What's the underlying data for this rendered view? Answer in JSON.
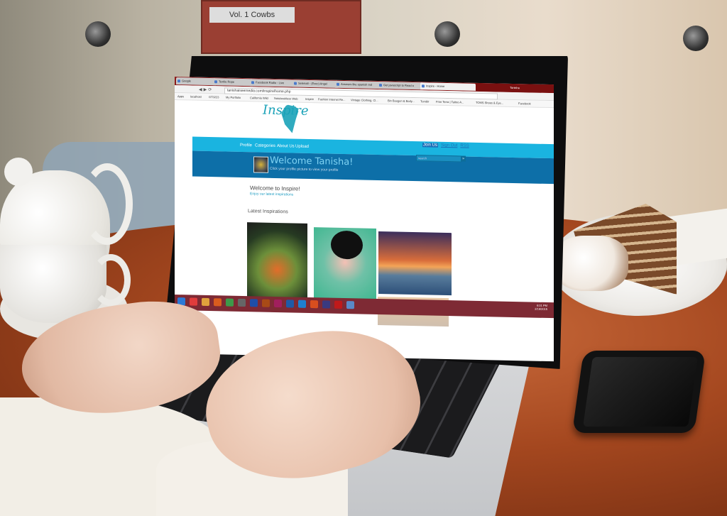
{
  "browser": {
    "tabs": [
      "Google",
      "Textile Rope",
      "Facebook Radio - Live",
      "Selena8 - (Exec) Angel",
      "Answers like spanish Ind",
      "Get javascript to Read a",
      "Inspire - Home"
    ],
    "window_user": "Tanisha",
    "url": "tanishaiseemedia.com/inspire/home.php",
    "bookmarks": [
      "Apps",
      "localhost",
      "GT3223",
      "My Portfolio",
      "California Wild",
      "Notebookless Web",
      "Inspire",
      "Fashion Internet Re...",
      "Vintage Clothing, Cl...",
      "Bin Baugen & Body...",
      "Tumblr",
      "Free Terra | Tattoo A...",
      "TOMS Shoes & Eye...",
      "Facebook"
    ]
  },
  "site": {
    "logo": "Inspire",
    "toplinks": {
      "join": "Join Us",
      "signout": "Sign Out",
      "rss": "RSS"
    },
    "nav": [
      "Profile",
      "Categories",
      "About Us",
      "Upload"
    ],
    "search_placeholder": "search",
    "search_button": "»",
    "welcome_title": "Welcome Tanisha!",
    "welcome_sub": "Click your profile picture to view your profile",
    "intro_title": "Welcome to Inspire!",
    "intro_sub": "Enjoy our latest inspirations",
    "section_title": "Latest Inspirations"
  },
  "taskbar": {
    "icons": [
      "windows-logo",
      "home",
      "folder",
      "media",
      "chrome",
      "app",
      "app",
      "illustrator",
      "indesign",
      "photoshop",
      "ie",
      "firefox",
      "app",
      "filezilla",
      "app"
    ],
    "icon_colors": [
      "#2b79d6",
      "#e03c3c",
      "#e0a23c",
      "#d95c1e",
      "#3d9a49",
      "#666666",
      "#1e4ea8",
      "#a84a16",
      "#a11f5d",
      "#1e5aa8",
      "#1e80d0",
      "#d84e1e",
      "#3a3a80",
      "#c01a1a",
      "#5a8ac8"
    ],
    "time": "6:01 PM",
    "date": "2/19/2015"
  },
  "scene": {
    "sign_text": "Vol. 1 Cowbs"
  }
}
